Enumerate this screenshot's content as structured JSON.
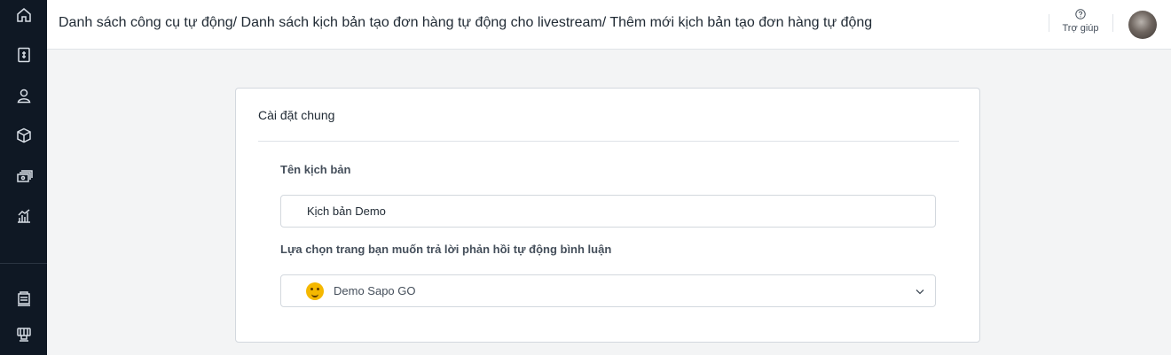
{
  "sidebar": {
    "items": [
      {
        "icon": "home-icon"
      },
      {
        "icon": "order-document-icon"
      },
      {
        "icon": "customer-icon"
      },
      {
        "icon": "product-box-icon"
      },
      {
        "icon": "cash-icon"
      },
      {
        "icon": "report-chart-icon"
      },
      {
        "icon": "sales-channel-icon"
      },
      {
        "icon": "pos-icon"
      }
    ]
  },
  "header": {
    "breadcrumb": "Danh sách công cụ tự động/ Danh sách kịch bản tạo đơn hàng tự động cho livestream/ Thêm mới kịch bản tạo đơn hàng tự động",
    "help_label": "Trợ giúp"
  },
  "card": {
    "title": "Cài đặt chung",
    "script_name_label": "Tên kịch bản",
    "script_name_value": "Kịch bản Demo",
    "page_select_label": "Lựa chọn trang bạn muốn trả lời phản hồi tự động bình luận",
    "page_select_value": "Demo Sapo GO"
  },
  "colors": {
    "sidebar_bg": "#0f1824",
    "page_bg": "#f3f4f5",
    "card_bg": "#ffffff"
  }
}
